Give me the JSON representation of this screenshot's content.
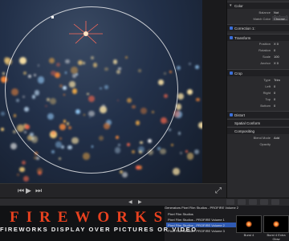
{
  "inspector": {
    "sections": [
      {
        "id": "color",
        "label": "Color"
      },
      {
        "id": "correction",
        "label": "Correction 1:"
      },
      {
        "id": "transform",
        "label": "Transform"
      },
      {
        "id": "crop",
        "label": "Crop"
      },
      {
        "id": "distort",
        "label": "Distort"
      },
      {
        "id": "spatial",
        "label": "Spatial Conform"
      },
      {
        "id": "compositing",
        "label": "Compositing"
      }
    ],
    "color_rows": [
      {
        "key": "Balance",
        "value": "Not Analyzed"
      },
      {
        "key": "Match Color",
        "value": "Choose..."
      }
    ],
    "transform_rows": [
      {
        "key": "Position",
        "value": "X 0"
      },
      {
        "key": "Rotation",
        "value": "0"
      },
      {
        "key": "Scale",
        "value": "100"
      },
      {
        "key": "Anchor",
        "value": "X 0"
      }
    ],
    "crop_rows": [
      {
        "key": "Type",
        "value": "Trim"
      },
      {
        "key": "Left",
        "value": "0"
      },
      {
        "key": "Right",
        "value": "0"
      },
      {
        "key": "Top",
        "value": "0"
      },
      {
        "key": "Bottom",
        "value": "0"
      }
    ],
    "compositing_rows": [
      {
        "key": "Blend Mode",
        "value": "Add"
      },
      {
        "key": "Opacity",
        "value": ""
      }
    ]
  },
  "browser": {
    "header": "Generators   Pixel Film Studios - PROFIRE Volume 2",
    "items": [
      "Pixel Film Studios",
      "Pixel Film Studios - PROFIRE Volume 1",
      "Pixel Film Studios - PROFIRE Volume 2",
      "Pixel Film Studios - PROFIRE Volume 3"
    ],
    "thumbs": [
      "Burst 4",
      "Burst 4 Extra Glow"
    ]
  },
  "banner": {
    "title": "FIREWORKS",
    "subtitle": "FIREWORKS DISPLAY OVER PICTURES OR VIDEO"
  },
  "colors": {
    "title": "#e8411f",
    "accent": "#2f5ab3"
  }
}
